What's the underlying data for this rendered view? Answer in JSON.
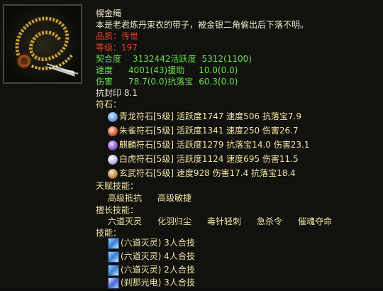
{
  "item": {
    "name": "幌金绳",
    "description": "本是老君炼丹束衣的带子，被金银二角偷出后下落不明。",
    "quality": "品质：传世",
    "level": "等级：197",
    "stats": [
      {
        "label": "契合度",
        "value": "3132442",
        "extra_label": "活跃度",
        "extra_value": "5312(1100)"
      },
      {
        "label": "速度",
        "value": "4001(43)",
        "extra_label": "援助",
        "extra_value": "10.0(0.0)"
      },
      {
        "label": "伤害",
        "value": "78.7(0.0)",
        "extra_label": "抗落宝",
        "extra_value": "60.3(0.0)"
      }
    ],
    "seal": "抗封印 8.1"
  },
  "gems": {
    "label": "符石：",
    "items": [
      {
        "name": "青龙符石[5级]",
        "stats": "活跃度1747 速度506 抗落宝7.9",
        "color": "#6fa0e0",
        "icon": "azure-dragon-gem-icon"
      },
      {
        "name": "朱雀符石[5级]",
        "stats": "活跃度1341 速度250 伤害26.7",
        "color": "#d86040",
        "icon": "vermilion-bird-gem-icon"
      },
      {
        "name": "麒麟符石[5级]",
        "stats": "活跃度1279 抗落宝14.0 伤害23.1",
        "color": "#9060d0",
        "icon": "qilin-gem-icon"
      },
      {
        "name": "白虎符石[5级]",
        "stats": "活跃度1124 速度695 伤害11.5",
        "color": "#c0b8e0",
        "icon": "white-tiger-gem-icon"
      },
      {
        "name": "玄武符石[5级]",
        "stats": "速度928 伤害17.4 抗落宝18.4",
        "color": "#c08a50",
        "icon": "black-tortoise-gem-icon"
      }
    ]
  },
  "talents": {
    "label": "天赋技能：",
    "items": [
      "高级抵抗",
      "高级敏捷"
    ]
  },
  "specialties": {
    "label": "擅长技能：",
    "items": [
      "六道灭灵",
      "化羽归尘",
      "毒针轻刺",
      "急杀令",
      "催魂夺命"
    ]
  },
  "techniques": {
    "label": "技能：",
    "items": [
      {
        "name": "(六道灭灵) 3人合技",
        "icon": "ice-skill-icon"
      },
      {
        "name": "(六道灭灵) 4人合技",
        "icon": "ice-skill-icon"
      },
      {
        "name": "(六道灭灵) 2人合技",
        "icon": "ice-skill-icon"
      },
      {
        "name": "(刹那光电) 3人合技",
        "icon": "lightning-skill-icon"
      }
    ]
  }
}
